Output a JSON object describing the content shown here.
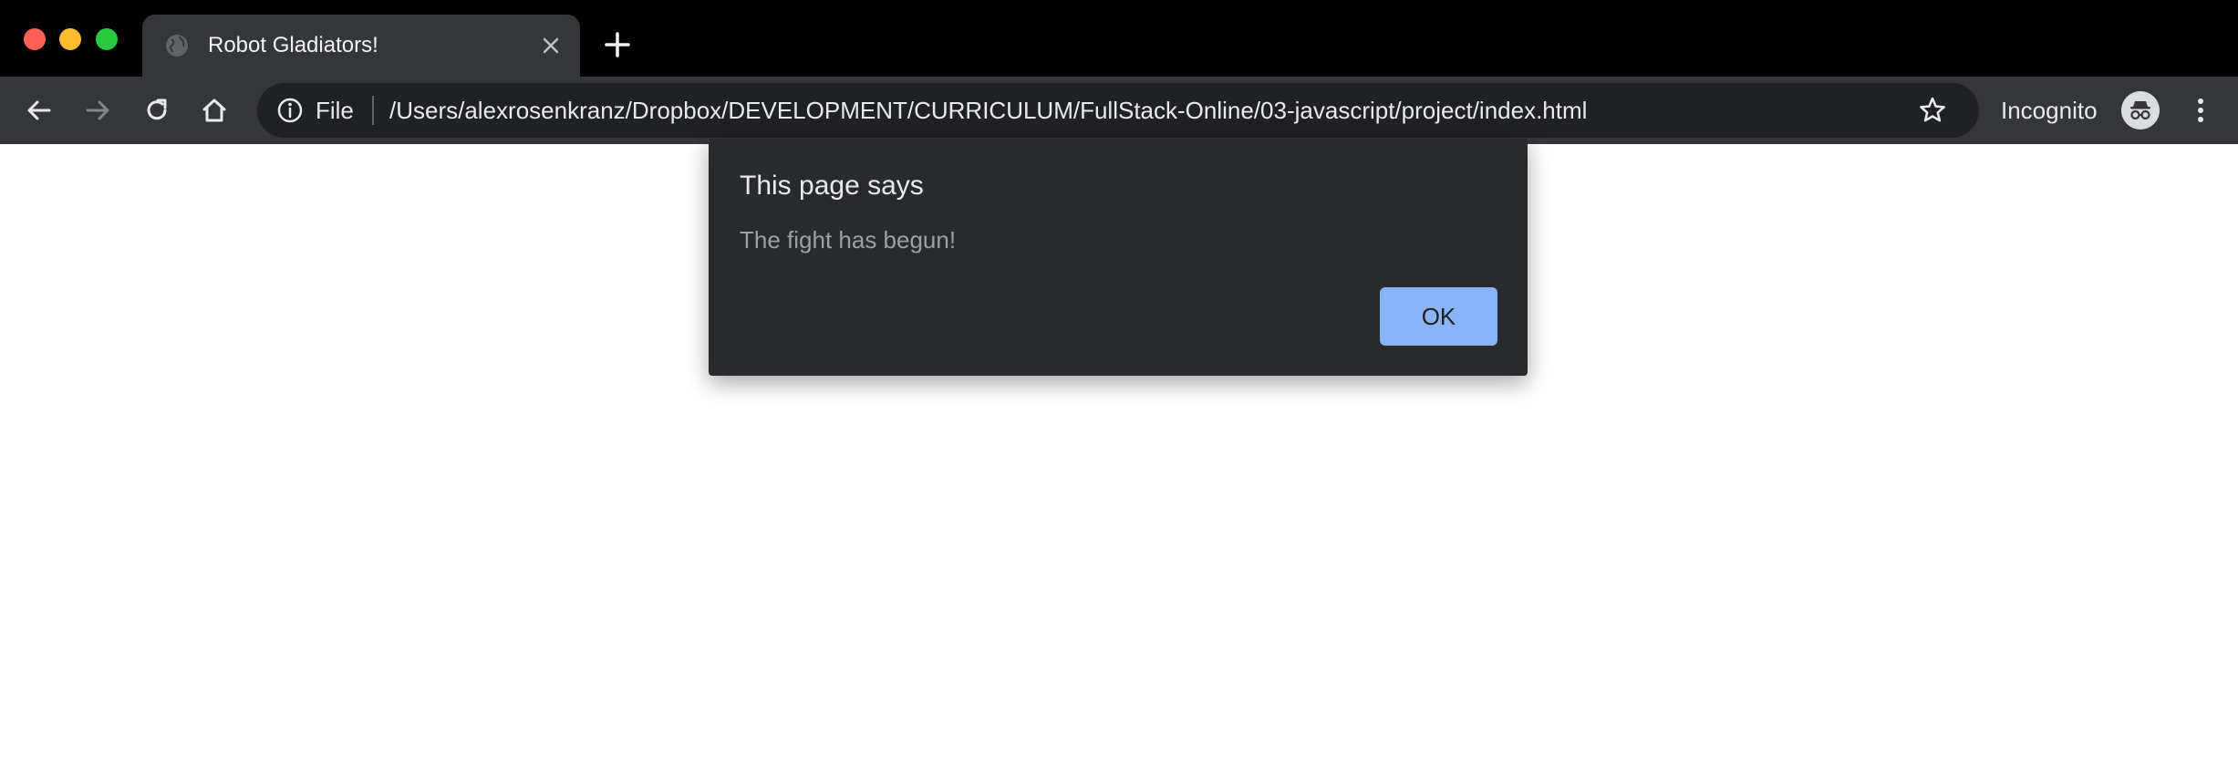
{
  "window": {
    "controls": [
      "close",
      "minimize",
      "maximize"
    ]
  },
  "tab": {
    "title": "Robot Gladiators!",
    "favicon": "globe-icon"
  },
  "toolbar": {
    "address": {
      "scheme_label": "File",
      "url": "/Users/alexrosenkranz/Dropbox/DEVELOPMENT/CURRICULUM/FullStack-Online/03-javascript/project/index.html"
    },
    "profile_label": "Incognito"
  },
  "dialog": {
    "title": "This page says",
    "message": "The fight has begun!",
    "ok_label": "OK"
  },
  "colors": {
    "tabstrip": "#000000",
    "toolbar": "#35363a",
    "omnibox": "#202124",
    "dialog": "#292a2d",
    "accent": "#8ab4f8"
  }
}
